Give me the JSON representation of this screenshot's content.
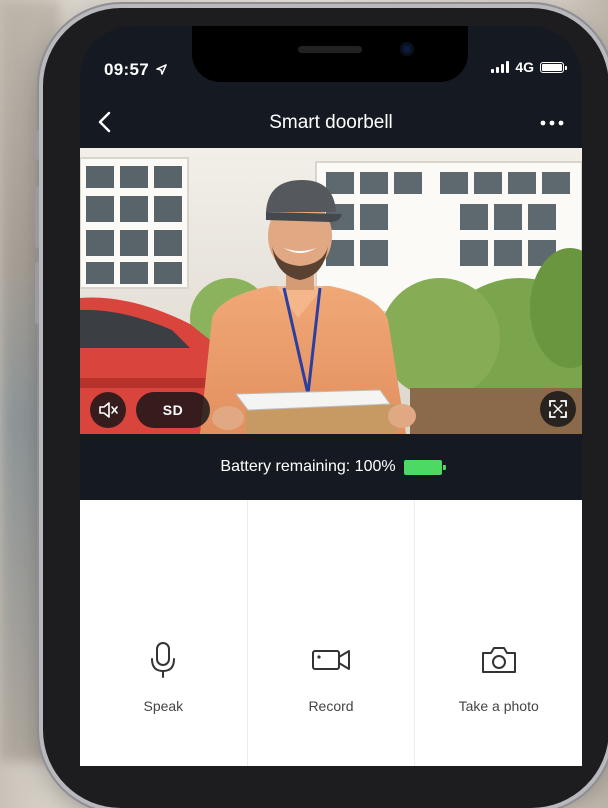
{
  "status_bar": {
    "time": "09:57",
    "network": "4G"
  },
  "header": {
    "title": "Smart doorbell",
    "back_icon": "chevron-left-icon",
    "more_icon": "more-dots-icon"
  },
  "video": {
    "stream_quality": "SD",
    "mute_icon": "speaker-mute-icon",
    "fullscreen_icon": "fullscreen-icon"
  },
  "battery": {
    "label": "Battery remaining: 100%",
    "level_percent": 100,
    "color": "#4cd964"
  },
  "actions": [
    {
      "label": "Speak",
      "icon": "microphone-icon"
    },
    {
      "label": "Record",
      "icon": "video-camera-icon"
    },
    {
      "label": "Take a photo",
      "icon": "camera-icon"
    }
  ],
  "colors": {
    "header_bg": "#151a22",
    "content_bg": "#ffffff",
    "accent_green": "#4cd964"
  }
}
